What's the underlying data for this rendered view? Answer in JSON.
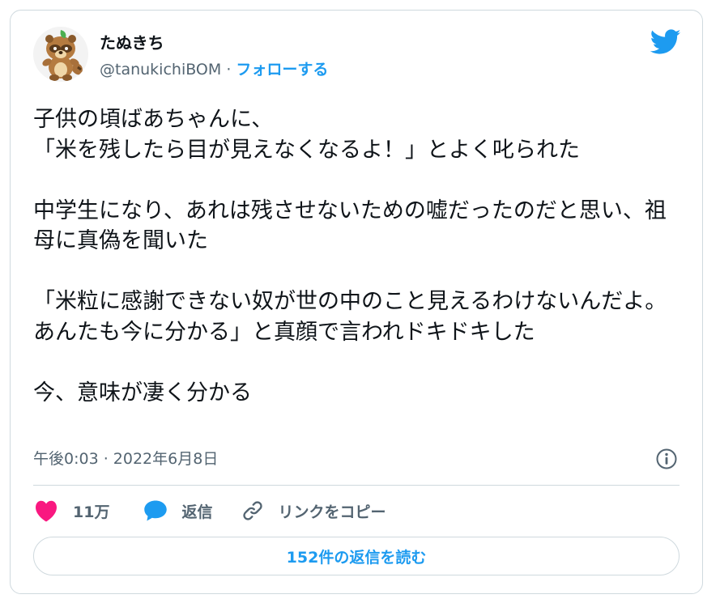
{
  "author": {
    "display_name": "たぬきち",
    "handle": "@tanukichiBOM",
    "separator": " · ",
    "follow_label": "フォローする",
    "avatar_icon": "tanuki-avatar-icon"
  },
  "tweet": {
    "text": "子供の頃ばあちゃんに、\n「米を残したら目が見えなくなるよ！」とよく叱られた\n\n中学生になり、あれは残させないための嘘だったのだと思い、祖母に真偽を聞いた\n\n「米粒に感謝できない奴が世の中のこと見えるわけないんだよ。あんたも今に分かる」と真顔で言われドキドキした\n\n今、意味が凄く分かる",
    "timestamp": "午後0:03 · 2022年6月8日"
  },
  "actions": {
    "like_count": "11万",
    "reply_label": "返信",
    "copy_link_label": "リンクをコピー"
  },
  "read_replies_label": "152件の返信を読む",
  "icons": {
    "twitter": "twitter-bird-icon",
    "info": "info-icon",
    "like": "heart-icon",
    "reply": "speech-bubble-icon",
    "link": "link-icon"
  },
  "colors": {
    "accent": "#1d9bf0",
    "like": "#f91880",
    "text": "#0f1419",
    "secondary": "#536471",
    "border": "#cfd9de"
  }
}
